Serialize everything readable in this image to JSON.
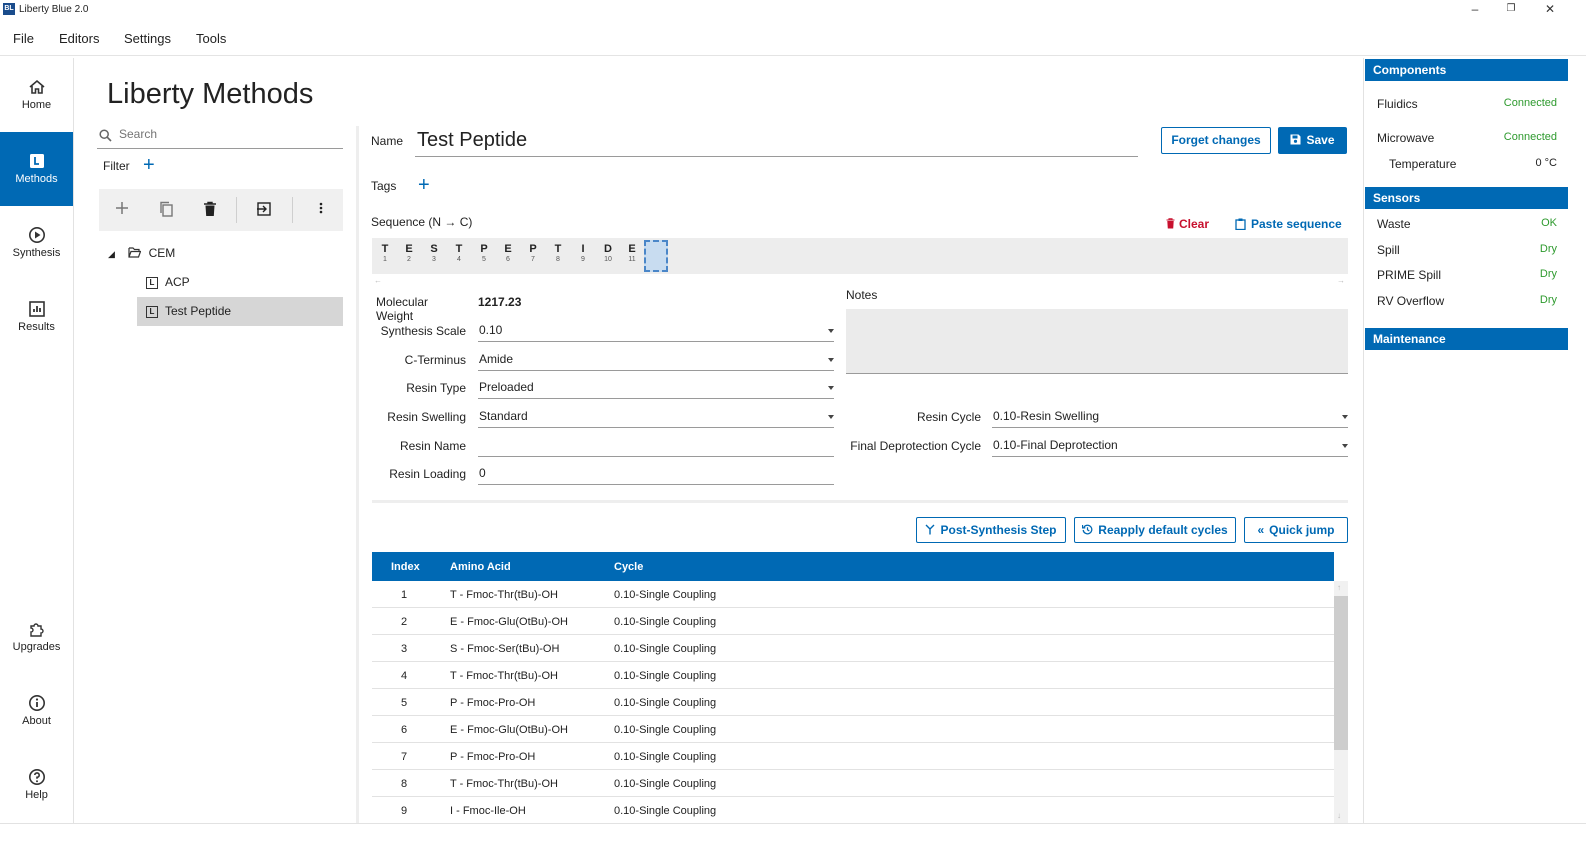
{
  "window": {
    "title": "Liberty Blue 2.0",
    "logo_text": "BL"
  },
  "menu": [
    "File",
    "Editors",
    "Settings",
    "Tools"
  ],
  "nav": {
    "home": "Home",
    "methods": "Methods",
    "synthesis": "Synthesis",
    "results": "Results",
    "upgrades": "Upgrades",
    "about": "About",
    "help": "Help"
  },
  "page_title": "Liberty Methods",
  "search": {
    "placeholder": "Search"
  },
  "filter_label": "Filter",
  "tree": {
    "root": "CEM",
    "children": [
      "ACP",
      "Test Peptide"
    ],
    "selected": "Test Peptide"
  },
  "method": {
    "name_label": "Name",
    "name": "Test Peptide",
    "forget_label": "Forget changes",
    "save_label": "Save",
    "tags_label": "Tags",
    "sequence_label": "Sequence (N → C)",
    "clear_label": "Clear",
    "paste_label": "Paste sequence",
    "sequence": [
      {
        "aa": "T",
        "n": "1"
      },
      {
        "aa": "E",
        "n": "2"
      },
      {
        "aa": "S",
        "n": "3"
      },
      {
        "aa": "T",
        "n": "4"
      },
      {
        "aa": "P",
        "n": "5"
      },
      {
        "aa": "E",
        "n": "6"
      },
      {
        "aa": "P",
        "n": "7"
      },
      {
        "aa": "T",
        "n": "8"
      },
      {
        "aa": "I",
        "n": "9"
      },
      {
        "aa": "D",
        "n": "10"
      },
      {
        "aa": "E",
        "n": "11"
      }
    ],
    "mw_label": "Molecular Weight",
    "mw": "1217.23",
    "notes_label": "Notes",
    "fields": {
      "synthesis_scale": {
        "label": "Synthesis Scale",
        "value": "0.10"
      },
      "c_terminus": {
        "label": "C-Terminus",
        "value": "Amide"
      },
      "resin_type": {
        "label": "Resin Type",
        "value": "Preloaded"
      },
      "resin_swelling": {
        "label": "Resin Swelling",
        "value": "Standard"
      },
      "resin_name": {
        "label": "Resin Name",
        "value": ""
      },
      "resin_loading": {
        "label": "Resin Loading",
        "value": "0"
      },
      "resin_cycle": {
        "label": "Resin Cycle",
        "value": "0.10-Resin Swelling"
      },
      "final_deprotection": {
        "label": "Final Deprotection Cycle",
        "value": "0.10-Final Deprotection"
      }
    },
    "post_synthesis_label": "Post-Synthesis Step",
    "reapply_label": "Reapply default cycles",
    "quick_jump_label": "Quick jump"
  },
  "table": {
    "columns": [
      "Index",
      "Amino Acid",
      "Cycle"
    ],
    "rows": [
      {
        "index": "1",
        "amino": "T - Fmoc-Thr(tBu)-OH",
        "cycle": "0.10-Single Coupling"
      },
      {
        "index": "2",
        "amino": "E - Fmoc-Glu(OtBu)-OH",
        "cycle": "0.10-Single Coupling"
      },
      {
        "index": "3",
        "amino": "S - Fmoc-Ser(tBu)-OH",
        "cycle": "0.10-Single Coupling"
      },
      {
        "index": "4",
        "amino": "T - Fmoc-Thr(tBu)-OH",
        "cycle": "0.10-Single Coupling"
      },
      {
        "index": "5",
        "amino": "P - Fmoc-Pro-OH",
        "cycle": "0.10-Single Coupling"
      },
      {
        "index": "6",
        "amino": "E - Fmoc-Glu(OtBu)-OH",
        "cycle": "0.10-Single Coupling"
      },
      {
        "index": "7",
        "amino": "P - Fmoc-Pro-OH",
        "cycle": "0.10-Single Coupling"
      },
      {
        "index": "8",
        "amino": "T - Fmoc-Thr(tBu)-OH",
        "cycle": "0.10-Single Coupling"
      },
      {
        "index": "9",
        "amino": "I - Fmoc-Ile-OH",
        "cycle": "0.10-Single Coupling"
      }
    ]
  },
  "panel": {
    "components_title": "Components",
    "fluidics": {
      "label": "Fluidics",
      "value": "Connected"
    },
    "microwave": {
      "label": "Microwave",
      "value": "Connected"
    },
    "temperature": {
      "label": "Temperature",
      "value": "0 °C"
    },
    "sensors_title": "Sensors",
    "waste": {
      "label": "Waste",
      "value": "OK"
    },
    "spill": {
      "label": "Spill",
      "value": "Dry"
    },
    "prime_spill": {
      "label": "PRIME Spill",
      "value": "Dry"
    },
    "rv_overflow": {
      "label": "RV Overflow",
      "value": "Dry"
    },
    "maintenance_title": "Maintenance"
  },
  "colors": {
    "accent": "#0069b4",
    "status_ok": "#2e9a2e",
    "clear": "#c8102e"
  }
}
